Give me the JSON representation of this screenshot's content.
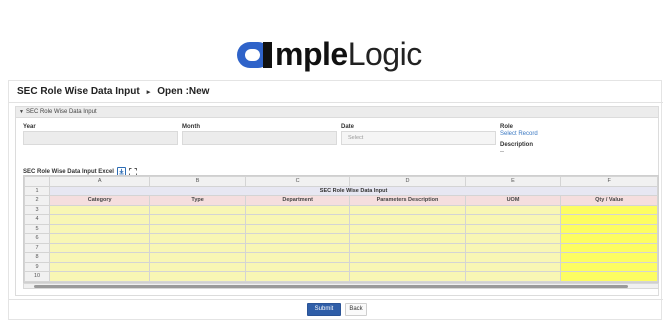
{
  "brand": {
    "logo_bold": "mple",
    "logo_light": "Logic"
  },
  "breadcrumb": {
    "title": "SEC Role Wise Data Input",
    "separator": "▸",
    "status": "Open :New"
  },
  "panel": {
    "header": "SEC Role Wise Data Input",
    "fields": {
      "year_label": "Year",
      "month_label": "Month",
      "date_label": "Date",
      "date_placeholder": "Select",
      "role_label": "Role",
      "role_link": "Select Record",
      "description_label": "Description",
      "description_value": "--"
    },
    "excel_label": "SEC Role Wise Data Input Excel"
  },
  "grid": {
    "columns": [
      "A",
      "B",
      "C",
      "D",
      "E",
      "F"
    ],
    "title_row": "SEC Role Wise Data Input",
    "headers": [
      "Category",
      "Type",
      "Department",
      "Parameters Description",
      "UOM",
      "Qty / Value"
    ],
    "row_numbers": [
      "1",
      "2",
      "3",
      "4",
      "5",
      "6",
      "7",
      "8",
      "9",
      "10"
    ]
  },
  "buttons": {
    "submit": "Submit",
    "back": "Back"
  },
  "colors": {
    "brand_blue": "#2f63c9",
    "submit_bg": "#2f5ea8",
    "input_yellow": "#f8f6b4",
    "qty_yellow": "#fdfd62",
    "header_pink": "#f5dede",
    "link_blue": "#3a78c2"
  }
}
